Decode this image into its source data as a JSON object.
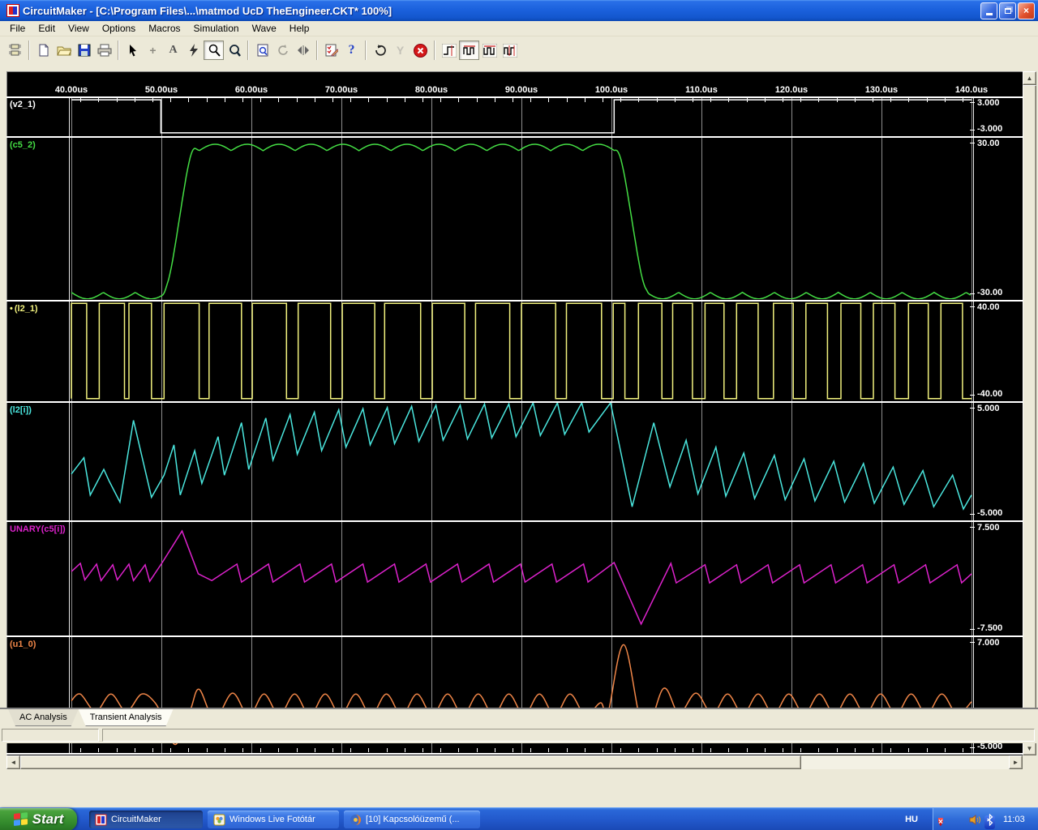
{
  "window": {
    "title": "CircuitMaker - [C:\\Program Files\\...\\matmod UcD TheEngineer.CKT* 100%]"
  },
  "menu": {
    "items": [
      "File",
      "Edit",
      "View",
      "Options",
      "Macros",
      "Simulation",
      "Wave",
      "Help"
    ]
  },
  "toolbar": {
    "glyphs": {
      "wire": "+",
      "text": "A",
      "help": "?",
      "wrench": "Y"
    }
  },
  "scrollbar": {
    "up": "▲",
    "down": "▼",
    "left": "◄",
    "right": "►"
  },
  "time_axis": {
    "labels": [
      "40.00us",
      "50.00us",
      "60.00us",
      "70.00us",
      "80.00us",
      "90.00us",
      "100.0us",
      "110.0us",
      "120.0us",
      "130.0us",
      "140.0us"
    ]
  },
  "panels": [
    {
      "name": "v2_1",
      "label": "(v2_1)",
      "color": "#ffffff",
      "vmax": 3,
      "vmin": -3,
      "vmax_label": "3.000",
      "vmin_label": "-3.000",
      "wave": {
        "type": "poly",
        "points": [
          [
            40,
            2.6
          ],
          [
            49.95,
            2.6
          ],
          [
            49.95,
            -2.6
          ],
          [
            100.3,
            -2.6
          ],
          [
            100.3,
            2.6
          ],
          [
            140,
            2.6
          ]
        ]
      }
    },
    {
      "name": "c5_2",
      "label": "(c5_2)",
      "color": "#44dd44",
      "vmax": 30,
      "vmin": -30,
      "vmax_label": "30.00",
      "vmin_label": "-30.00",
      "wave": {
        "type": "envelope",
        "low": -27.5,
        "high": 25.2,
        "rise": [
          50.1,
          53.8
        ],
        "fall": [
          100.4,
          104.2
        ],
        "ripple_amp": 2.4,
        "ripple_period": 3.55
      }
    },
    {
      "name": "l2_1",
      "label": "(l2_1)",
      "marker": "•",
      "color": "#f2f27e",
      "vmax": 40,
      "vmin": -40,
      "vmax_label": "40.00",
      "vmin_label": "-40.00",
      "wave": {
        "type": "pwm",
        "high": 38.5,
        "low": -38.5,
        "highs": [
          [
            40,
            41.7
          ],
          [
            43.1,
            45.9
          ],
          [
            46.4,
            48.9
          ],
          [
            50.3,
            54.2
          ],
          [
            55.3,
            58.9
          ],
          [
            60.1,
            63.9
          ],
          [
            65.2,
            68.8
          ],
          [
            70.1,
            73.7
          ],
          [
            74.8,
            78.8
          ],
          [
            80.1,
            83.7
          ],
          [
            84.9,
            88.7
          ],
          [
            90,
            93.8
          ],
          [
            95,
            98.9
          ],
          [
            100.2,
            101.5
          ],
          [
            103,
            105.6
          ],
          [
            106.8,
            109
          ],
          [
            110.4,
            112.5
          ],
          [
            113.9,
            116.3
          ],
          [
            118,
            120.2
          ],
          [
            121.6,
            124
          ],
          [
            125.5,
            127.7
          ],
          [
            129.1,
            131.5
          ],
          [
            133,
            135.2
          ],
          [
            136.6,
            139
          ]
        ]
      }
    },
    {
      "name": "l2_i",
      "label": "(l2[i])",
      "color": "#4ae6de",
      "vmax": 5,
      "vmin": -5,
      "vmax_label": "5.000",
      "vmin_label": "-5.000",
      "wave": {
        "type": "poly",
        "points": [
          [
            40,
            -1.1
          ],
          [
            41.4,
            0.3
          ],
          [
            42.1,
            -2.9
          ],
          [
            43.6,
            -0.7
          ],
          [
            44.2,
            -1.7
          ],
          [
            45.4,
            -3.5
          ],
          [
            46.9,
            3.5
          ],
          [
            48.9,
            -3.1
          ],
          [
            50.3,
            -1.2
          ],
          [
            51.4,
            1.4
          ],
          [
            52.1,
            -2.9
          ],
          [
            53.7,
            0.9
          ],
          [
            54.5,
            -1.9
          ],
          [
            56.3,
            2.1
          ],
          [
            57,
            -1.2
          ],
          [
            58.9,
            3.3
          ],
          [
            59.7,
            -0.7
          ],
          [
            61.6,
            3.7
          ],
          [
            62.4,
            0.1
          ],
          [
            64.3,
            4
          ],
          [
            65.1,
            0.6
          ],
          [
            67,
            4.2
          ],
          [
            67.8,
            0.9
          ],
          [
            69.7,
            4.4
          ],
          [
            70.5,
            1.2
          ],
          [
            72.4,
            4.5
          ],
          [
            73.2,
            1.4
          ],
          [
            75.1,
            4.6
          ],
          [
            75.9,
            1.5
          ],
          [
            77.8,
            4.7
          ],
          [
            78.6,
            1.7
          ],
          [
            80.5,
            4.8
          ],
          [
            81.3,
            1.8
          ],
          [
            83.2,
            4.8
          ],
          [
            84,
            1.9
          ],
          [
            85.9,
            4.9
          ],
          [
            86.7,
            2
          ],
          [
            88.6,
            4.9
          ],
          [
            89.4,
            2.1
          ],
          [
            91.3,
            5
          ],
          [
            92.1,
            2.2
          ],
          [
            94,
            5
          ],
          [
            94.8,
            2.3
          ],
          [
            96.7,
            5
          ],
          [
            97.5,
            2.5
          ],
          [
            99.9,
            5
          ],
          [
            102.3,
            -3.9
          ],
          [
            104.7,
            3.3
          ],
          [
            106.5,
            -2.2
          ],
          [
            108.3,
            1.8
          ],
          [
            109.6,
            -2.8
          ],
          [
            111.6,
            1.2
          ],
          [
            112.7,
            -3
          ],
          [
            114.7,
            0.7
          ],
          [
            115.9,
            -3.2
          ],
          [
            118.1,
            0.5
          ],
          [
            119.3,
            -3.3
          ],
          [
            121.4,
            0.2
          ],
          [
            122.6,
            -3.4
          ],
          [
            124.7,
            0
          ],
          [
            125.9,
            -3.5
          ],
          [
            128,
            -0.2
          ],
          [
            129.2,
            -3.6
          ],
          [
            131.3,
            -0.5
          ],
          [
            132.5,
            -3.7
          ],
          [
            134.6,
            -0.8
          ],
          [
            135.8,
            -3.9
          ],
          [
            137.9,
            -1.2
          ],
          [
            139.1,
            -4.1
          ],
          [
            140,
            -2.9
          ]
        ]
      }
    },
    {
      "name": "unary_c5_i",
      "label": "UNARY(c5[i])",
      "color": "#dd22cc",
      "vmax": 7.5,
      "vmin": -7.5,
      "vmax_label": "7.500",
      "vmin_label": "-7.500",
      "wave": {
        "type": "poly",
        "points": [
          [
            40,
            0.9
          ],
          [
            41,
            2
          ],
          [
            41.5,
            -0.2
          ],
          [
            42.8,
            1.9
          ],
          [
            43.3,
            -0.3
          ],
          [
            44.6,
            1.8
          ],
          [
            45.1,
            -0.2
          ],
          [
            46.4,
            1.9
          ],
          [
            46.9,
            -0.3
          ],
          [
            48.2,
            1.8
          ],
          [
            48.7,
            -0.4
          ],
          [
            50.1,
            2.1
          ],
          [
            52.3,
            6.3
          ],
          [
            54.1,
            0.6
          ],
          [
            55.6,
            -0.3
          ],
          [
            58.4,
            1.9
          ],
          [
            58.9,
            -0.5
          ],
          [
            61.9,
            1.9
          ],
          [
            62.4,
            -0.5
          ],
          [
            65.4,
            1.9
          ],
          [
            65.9,
            -0.5
          ],
          [
            68.9,
            1.9
          ],
          [
            69.4,
            -0.5
          ],
          [
            72.4,
            1.9
          ],
          [
            72.9,
            -0.5
          ],
          [
            75.9,
            1.9
          ],
          [
            76.4,
            -0.5
          ],
          [
            79.4,
            1.9
          ],
          [
            79.9,
            -0.5
          ],
          [
            82.9,
            1.9
          ],
          [
            83.4,
            -0.5
          ],
          [
            86.4,
            1.9
          ],
          [
            86.9,
            -0.5
          ],
          [
            89.9,
            1.9
          ],
          [
            90.4,
            -0.5
          ],
          [
            93.4,
            1.9
          ],
          [
            93.9,
            -0.5
          ],
          [
            96.9,
            1.9
          ],
          [
            97.4,
            -0.5
          ],
          [
            100.3,
            2.1
          ],
          [
            103.3,
            -6.1
          ],
          [
            106.6,
            2
          ],
          [
            107.2,
            -0.6
          ],
          [
            110.4,
            1.8
          ],
          [
            110.9,
            -0.6
          ],
          [
            113.9,
            1.8
          ],
          [
            114.4,
            -0.6
          ],
          [
            117.4,
            1.8
          ],
          [
            117.9,
            -0.6
          ],
          [
            120.9,
            1.8
          ],
          [
            121.4,
            -0.6
          ],
          [
            124.4,
            1.8
          ],
          [
            124.9,
            -0.6
          ],
          [
            127.9,
            1.8
          ],
          [
            128.4,
            -0.6
          ],
          [
            131.4,
            1.8
          ],
          [
            131.9,
            -0.6
          ],
          [
            134.9,
            1.8
          ],
          [
            135.4,
            -0.6
          ],
          [
            138.4,
            1.8
          ],
          [
            138.9,
            -0.6
          ],
          [
            140,
            0.6
          ]
        ]
      }
    },
    {
      "name": "u1_0",
      "label": "(u1_0)",
      "color": "#f08648",
      "vmax": 7,
      "vmin": -5,
      "vmax_label": "7.000",
      "vmin_label": "-5.000",
      "wave": {
        "type": "smooth",
        "points": [
          [
            40,
            0.4
          ],
          [
            41,
            1.1
          ],
          [
            42.7,
            -0.7
          ],
          [
            44.4,
            1.1
          ],
          [
            46.1,
            -0.7
          ],
          [
            47.8,
            1.1
          ],
          [
            49.3,
            0.2
          ],
          [
            50.4,
            -1.8
          ],
          [
            51.6,
            -4.1
          ],
          [
            53.2,
            -0.6
          ],
          [
            54.2,
            1.6
          ],
          [
            55.9,
            -1.5
          ],
          [
            57.9,
            1.2
          ],
          [
            59.7,
            -1.2
          ],
          [
            61.4,
            1.1
          ],
          [
            63.1,
            -1.1
          ],
          [
            64.8,
            1.1
          ],
          [
            66.5,
            -1.1
          ],
          [
            68.2,
            1.1
          ],
          [
            69.9,
            -1.1
          ],
          [
            71.6,
            1.1
          ],
          [
            73.3,
            -1.1
          ],
          [
            75,
            1.1
          ],
          [
            76.7,
            -1.1
          ],
          [
            78.4,
            1.1
          ],
          [
            80.1,
            -1.1
          ],
          [
            81.8,
            1.1
          ],
          [
            83.5,
            -1.1
          ],
          [
            85.2,
            1.1
          ],
          [
            86.9,
            -1.1
          ],
          [
            88.6,
            1.1
          ],
          [
            90.3,
            -1.1
          ],
          [
            92,
            1.1
          ],
          [
            93.7,
            -1.1
          ],
          [
            95.4,
            1.1
          ],
          [
            97.1,
            -1.1
          ],
          [
            98.8,
            0.2
          ],
          [
            99.6,
            -0.9
          ],
          [
            101.4,
            6.2
          ],
          [
            103.6,
            -2.7
          ],
          [
            105.8,
            1.7
          ],
          [
            107.5,
            -0.9
          ],
          [
            109.4,
            1.2
          ],
          [
            111.2,
            -1
          ],
          [
            112.9,
            1.1
          ],
          [
            114.6,
            -1
          ],
          [
            116.3,
            1.1
          ],
          [
            118,
            -1
          ],
          [
            119.7,
            1.1
          ],
          [
            121.4,
            -1
          ],
          [
            123.1,
            1.1
          ],
          [
            124.8,
            -1
          ],
          [
            126.5,
            1.1
          ],
          [
            128.2,
            -1
          ],
          [
            129.9,
            1.1
          ],
          [
            131.6,
            -1
          ],
          [
            133.3,
            1.1
          ],
          [
            135,
            -1
          ],
          [
            136.7,
            1.1
          ],
          [
            138.4,
            -1
          ],
          [
            140,
            0.3
          ]
        ]
      }
    }
  ],
  "tabs": {
    "items": [
      {
        "label": "AC Analysis"
      },
      {
        "label": "Transient Analysis"
      }
    ]
  },
  "taskbar": {
    "start_label": "Start",
    "tasks": [
      {
        "label": "CircuitMaker"
      },
      {
        "label": "Windows Live Fotótár"
      },
      {
        "label": "[10] Kapcsolóüzemű (..."
      }
    ],
    "tray": {
      "language": "HU",
      "clock": "11:03"
    }
  }
}
